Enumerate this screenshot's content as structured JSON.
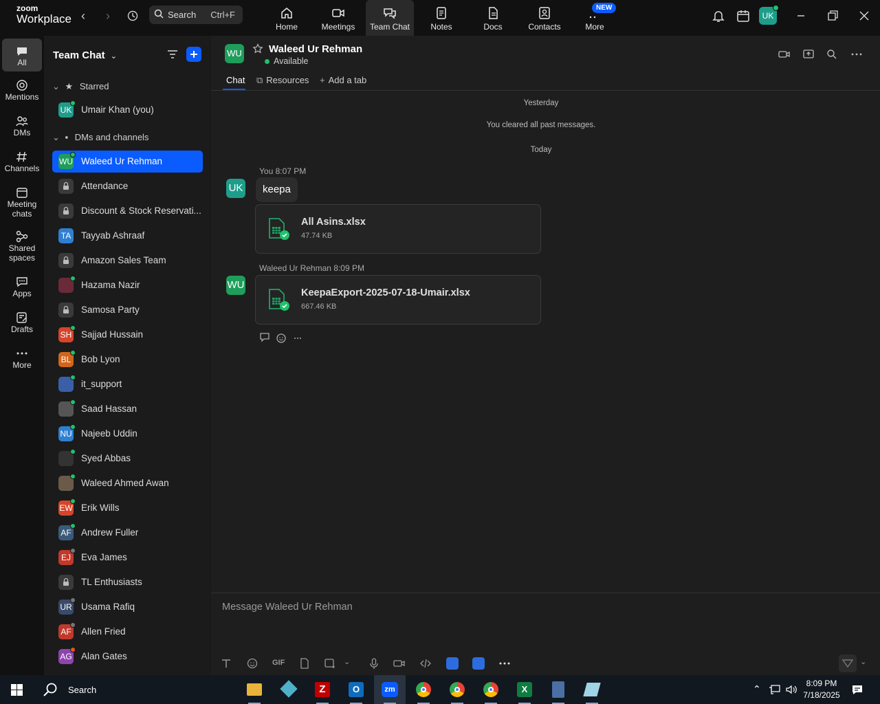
{
  "app": {
    "brand_small": "zoom",
    "brand_big": "Workplace",
    "search_label": "Search",
    "search_shortcut": "Ctrl+F",
    "new_badge": "NEW",
    "user_initials": "UK"
  },
  "topnav": [
    {
      "label": "Home",
      "icon": "home-icon"
    },
    {
      "label": "Meetings",
      "icon": "video-icon"
    },
    {
      "label": "Team Chat",
      "icon": "chat-icon"
    },
    {
      "label": "Notes",
      "icon": "notes-icon"
    },
    {
      "label": "Docs",
      "icon": "docs-icon"
    },
    {
      "label": "Contacts",
      "icon": "contacts-icon"
    },
    {
      "label": "More",
      "icon": "more-icon"
    }
  ],
  "rail": [
    {
      "label": "All"
    },
    {
      "label": "Mentions"
    },
    {
      "label": "DMs"
    },
    {
      "label": "Channels"
    },
    {
      "label": "Meeting chats"
    },
    {
      "label": "Shared spaces"
    },
    {
      "label": "Apps"
    },
    {
      "label": "Drafts"
    },
    {
      "label": "More"
    }
  ],
  "sidebar": {
    "title": "Team Chat",
    "starred_label": "Starred",
    "dms_label": "DMs and channels",
    "starred": [
      {
        "initials": "UK",
        "name": "Umair Khan (you)",
        "color": "#1e9e8a",
        "status": "online"
      }
    ],
    "items": [
      {
        "initials": "WU",
        "name": "Waleed Ur Rehman",
        "color": "#1e9e5a",
        "status": "online",
        "active": true
      },
      {
        "initials": "",
        "name": "Attendance",
        "type": "channel"
      },
      {
        "initials": "",
        "name": "Discount & Stock Reservati...",
        "type": "channel"
      },
      {
        "initials": "TA",
        "name": "Tayyab Ashraaf",
        "color": "#2f7fd1",
        "status": "none"
      },
      {
        "initials": "",
        "name": "Amazon Sales Team",
        "type": "channel"
      },
      {
        "initials": "",
        "name": "Hazama Nazir",
        "color": "#6a2a3a",
        "status": "online"
      },
      {
        "initials": "",
        "name": "Samosa Party",
        "type": "channel"
      },
      {
        "initials": "SH",
        "name": "Sajjad Hussain",
        "color": "#d6452b",
        "status": "online"
      },
      {
        "initials": "BL",
        "name": "Bob Lyon",
        "color": "#d1661b",
        "status": "online"
      },
      {
        "initials": "",
        "name": "it_support",
        "color": "#3b5ea8",
        "status": "online"
      },
      {
        "initials": "",
        "name": "Saad Hassan",
        "color": "#555555",
        "status": "online"
      },
      {
        "initials": "NU",
        "name": "Najeeb Uddin",
        "color": "#2f7fd1",
        "status": "online"
      },
      {
        "initials": "",
        "name": "Syed Abbas",
        "color": "#333333",
        "status": "online"
      },
      {
        "initials": "",
        "name": "Waleed Ahmed Awan",
        "color": "#6b5a4a",
        "status": "online"
      },
      {
        "initials": "EW",
        "name": "Erik Wills",
        "color": "#d6452b",
        "status": "online"
      },
      {
        "initials": "AF",
        "name": "Andrew Fuller",
        "color": "#3a5a7a",
        "status": "online"
      },
      {
        "initials": "EJ",
        "name": "Eva James",
        "color": "#c0392b",
        "status": "away"
      },
      {
        "initials": "",
        "name": "TL Enthusiasts",
        "type": "channel"
      },
      {
        "initials": "UR",
        "name": "Usama Rafiq",
        "color": "#3a4a6a",
        "status": "away"
      },
      {
        "initials": "AF",
        "name": "Allen Fried",
        "color": "#c0392b",
        "status": "away"
      },
      {
        "initials": "AG",
        "name": "Alan Gates",
        "color": "#8e44ad",
        "status": "busy"
      }
    ]
  },
  "chat": {
    "contact_initials": "WU",
    "contact_name": "Waleed Ur Rehman",
    "contact_status": "Available",
    "tabs": [
      "Chat",
      "Resources",
      "Add a tab"
    ],
    "day_yesterday": "Yesterday",
    "cleared_note": "You cleared all past messages.",
    "day_today": "Today",
    "messages": [
      {
        "initials": "UK",
        "sender": "You",
        "time": "8:07 PM",
        "text": "keepa",
        "file_name": "All Asins.xlsx",
        "file_size": "47.74 KB"
      },
      {
        "initials": "WU",
        "sender": "Waleed Ur Rehman",
        "time": "8:09 PM",
        "file_name": "KeepaExport-2025-07-18-Umair.xlsx",
        "file_size": "667.46 KB"
      }
    ],
    "composer_placeholder": "Message Waleed Ur Rehman",
    "gif_label": "GIF"
  },
  "taskbar": {
    "search_label": "Search",
    "time": "8:09 PM",
    "date": "7/18/2025"
  },
  "colors": {
    "accent": "#0b5cff",
    "online": "#1fc26b",
    "excel_green": "#21a366"
  }
}
